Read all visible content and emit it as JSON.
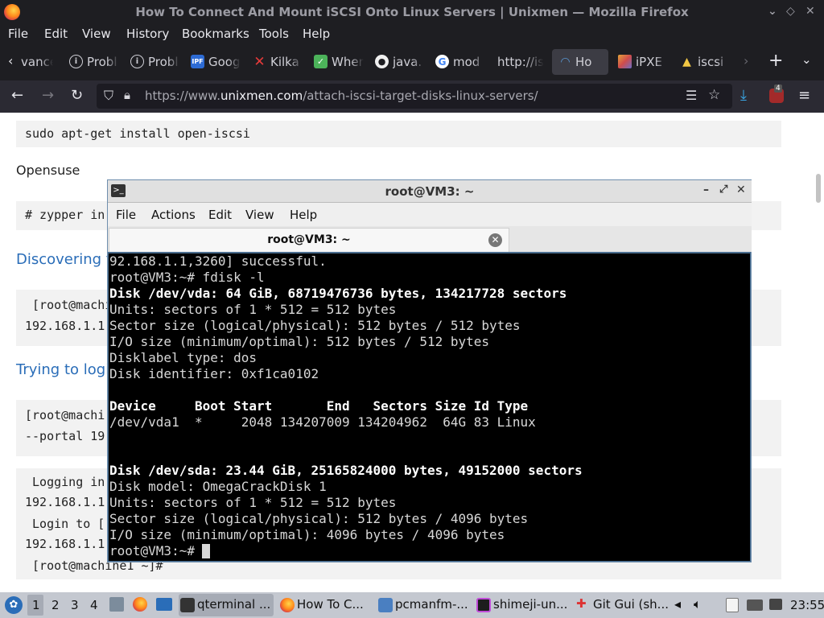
{
  "window": {
    "title": "How To Connect And Mount iSCSI Onto Linux Servers | Unixmen — Mozilla Firefox"
  },
  "menu": {
    "file": "File",
    "edit": "Edit",
    "view": "View",
    "history": "History",
    "bookmarks": "Bookmarks",
    "tools": "Tools",
    "help": "Help"
  },
  "tabs": [
    {
      "label": "vance",
      "icon": "back-arrow-icon"
    },
    {
      "label": "Probl",
      "icon": "info-icon"
    },
    {
      "label": "Probl",
      "icon": "info-icon"
    },
    {
      "label": "Goog",
      "icon": "ipfs-icon"
    },
    {
      "label": "Kilka",
      "icon": "x-icon"
    },
    {
      "label": "When",
      "icon": "check-icon"
    },
    {
      "label": "java.",
      "icon": "github-icon"
    },
    {
      "label": "mod",
      "icon": "google-icon"
    },
    {
      "label": "http://is",
      "icon": ""
    },
    {
      "label": "Ho",
      "icon": "unixmen-icon"
    },
    {
      "label": "iPXE",
      "icon": "ipxe-icon"
    },
    {
      "label": "iscsi",
      "icon": "linux-icon"
    }
  ],
  "nav": {
    "url_prefix": "https://www.",
    "url_domain": "unixmen.com",
    "url_path": "/attach-iscsi-target-disks-linux-servers/",
    "downloads_badge": "4"
  },
  "page": {
    "code1": "sudo apt-get install open-iscsi",
    "opensuse": "Opensuse",
    "code2": "# zypper in",
    "heading1": "Discovering t",
    "code3_line1": " [root@machi",
    "code3_line2": "192.168.1.1",
    "heading2": "Trying to logi",
    "code4_line1": "[root@machi",
    "code4_line2": "--portal 19",
    "code5_line1": " Logging in",
    "code5_line2": "192.168.1.1",
    "code5_line3": " Login to [",
    "code5_line4": "192.168.1.1",
    "code5_line5": " [root@machine1 ~]#"
  },
  "terminal": {
    "title": "root@VM3: ~",
    "menu": {
      "file": "File",
      "actions": "Actions",
      "edit": "Edit",
      "view": "View",
      "help": "Help"
    },
    "tab_label": "root@VM3: ~",
    "lines": [
      {
        "text": "92.168.1.1,3260] successful.",
        "bold": false
      },
      {
        "text": "root@VM3:~# fdisk -l",
        "bold": false
      },
      {
        "text": "Disk /dev/vda: 64 GiB, 68719476736 bytes, 134217728 sectors",
        "bold": true
      },
      {
        "text": "Units: sectors of 1 * 512 = 512 bytes",
        "bold": false
      },
      {
        "text": "Sector size (logical/physical): 512 bytes / 512 bytes",
        "bold": false
      },
      {
        "text": "I/O size (minimum/optimal): 512 bytes / 512 bytes",
        "bold": false
      },
      {
        "text": "Disklabel type: dos",
        "bold": false
      },
      {
        "text": "Disk identifier: 0xf1ca0102",
        "bold": false
      },
      {
        "text": "",
        "bold": false
      },
      {
        "text": "Device     Boot Start       End   Sectors Size Id Type",
        "bold": true
      },
      {
        "text": "/dev/vda1  *     2048 134207009 134204962  64G 83 Linux",
        "bold": false
      },
      {
        "text": "",
        "bold": false
      },
      {
        "text": "",
        "bold": false
      },
      {
        "text": "Disk /dev/sda: 23.44 GiB, 25165824000 bytes, 49152000 sectors",
        "bold": true
      },
      {
        "text": "Disk model: OmegaCrackDisk 1",
        "bold": false
      },
      {
        "text": "Units: sectors of 1 * 512 = 512 bytes",
        "bold": false
      },
      {
        "text": "Sector size (logical/physical): 512 bytes / 4096 bytes",
        "bold": false
      },
      {
        "text": "I/O size (minimum/optimal): 4096 bytes / 4096 bytes",
        "bold": false
      },
      {
        "text": "root@VM3:~# ",
        "bold": false
      }
    ]
  },
  "taskbar": {
    "workspaces": [
      "1",
      "2",
      "3",
      "4"
    ],
    "tasks": [
      {
        "label": "qterminal ...",
        "icon": "terminal-icon"
      },
      {
        "label": "How To C...",
        "icon": "firefox-icon"
      },
      {
        "label": "pcmanfm-...",
        "icon": "folder-icon"
      },
      {
        "label": "shimeji-un...",
        "icon": "intellij-icon"
      },
      {
        "label": "Git Gui (sh...",
        "icon": "git-icon"
      }
    ],
    "clock": "23:55"
  }
}
